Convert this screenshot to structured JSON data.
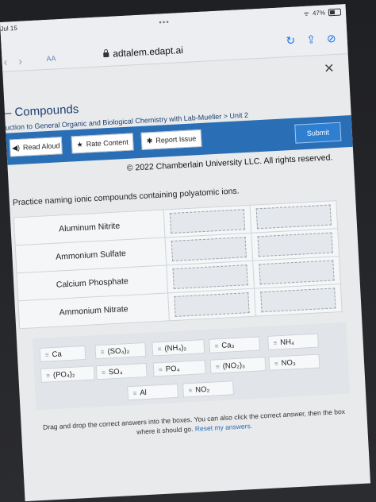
{
  "status": {
    "time": "Jul 15",
    "battery": "47%"
  },
  "browser": {
    "aa": "AA",
    "url": "adtalem.edapt.ai"
  },
  "page": {
    "title": "Compounds",
    "breadcrumb": "uction to General Organic and Biological Chemistry with Lab-Mueller > Unit 2"
  },
  "toolbar": {
    "read_aloud": "Read Aloud",
    "rate_content": "Rate Content",
    "report_issue": "Report Issue",
    "submit": "Submit"
  },
  "copyright": "© 2022 Chamberlain University LLC. All rights reserved.",
  "instructions": "Practice naming ionic compounds containing polyatomic ions.",
  "rows": [
    {
      "label": "Aluminum Nitrite"
    },
    {
      "label": "Ammonium Sulfate"
    },
    {
      "label": "Calcium Phosphate"
    },
    {
      "label": "Ammonium Nitrate"
    }
  ],
  "answers": [
    {
      "label": "Ca"
    },
    {
      "label": "(SO₄)₂"
    },
    {
      "label": "(NH₄)₂"
    },
    {
      "label": "Ca₃"
    },
    {
      "label": "NH₄"
    },
    {
      "label": "(PO₄)₂"
    },
    {
      "label": "SO₄"
    },
    {
      "label": "PO₄"
    },
    {
      "label": "(NO₂)₃"
    },
    {
      "label": "NO₃"
    },
    {
      "label": "Al"
    },
    {
      "label": "NO₂"
    }
  ],
  "footer": {
    "line1": "Drag and drop the correct answers into the boxes. You can also click the correct answer, then the box",
    "line2": "where it should go.",
    "reset": "Reset my answers."
  }
}
